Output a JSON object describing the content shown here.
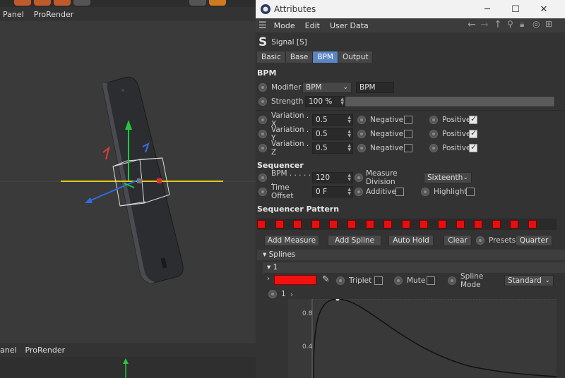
{
  "viewport": {
    "menu_top": [
      "Panel",
      "ProRender"
    ],
    "menu_bottom": [
      "anel",
      "ProRender"
    ]
  },
  "window": {
    "title": "Attributes",
    "minimize": "─",
    "maximize": "☐",
    "close": "✕"
  },
  "menubar": {
    "items": [
      "Mode",
      "Edit",
      "User Data"
    ]
  },
  "object": {
    "name": "Signal [S]",
    "icon_letter": "S"
  },
  "tabs": [
    {
      "label": "Basic",
      "active": false
    },
    {
      "label": "Base",
      "active": false
    },
    {
      "label": "BPM",
      "active": true
    },
    {
      "label": "Output",
      "active": false
    }
  ],
  "bpm_section": {
    "title": "BPM",
    "modifier_label": "Modifier",
    "modifier_value": "BPM",
    "modifier_text": "BPM",
    "strength_label": "Strength",
    "strength_value": "100 %",
    "variation_x_label": "Variation . X",
    "variation_x_value": "0.5",
    "variation_y_label": "Variation . Y",
    "variation_y_value": "0.5",
    "variation_z_label": "Variation . Z",
    "variation_z_value": "0.5",
    "negative_label": "Negative",
    "positive_label": "Positive"
  },
  "sequencer": {
    "title": "Sequencer",
    "bpm_label": "BPM . . . . . .",
    "bpm_value": "120",
    "measure_label": "Measure Division",
    "measure_value": "Sixteenth",
    "time_offset_label": "Time Offset",
    "time_offset_value": "0 F",
    "additive_label": "Additive",
    "highlight_label": "Highlight"
  },
  "pattern": {
    "title": "Sequencer Pattern",
    "cells": 16
  },
  "buttons": {
    "add_measure": "Add Measure",
    "add_spline": "Add Spline",
    "auto_hold": "Auto Hold",
    "clear": "Clear",
    "presets_label": "Presets",
    "presets_value": "Quarter"
  },
  "splines": {
    "header": "Splines",
    "item": "1",
    "triplet_label": "Triplet",
    "mute_label": "Mute",
    "spline_mode_label": "Spline Mode",
    "spline_mode_value": "Standard",
    "sub_item": "1",
    "swatch_color": "#f21111",
    "y_ticks": [
      "0.8",
      "0.4"
    ]
  },
  "colors": {
    "active_tab": "#5b86c2",
    "panel_bg": "#333333",
    "viewport_bg": "#3a3a3a"
  }
}
